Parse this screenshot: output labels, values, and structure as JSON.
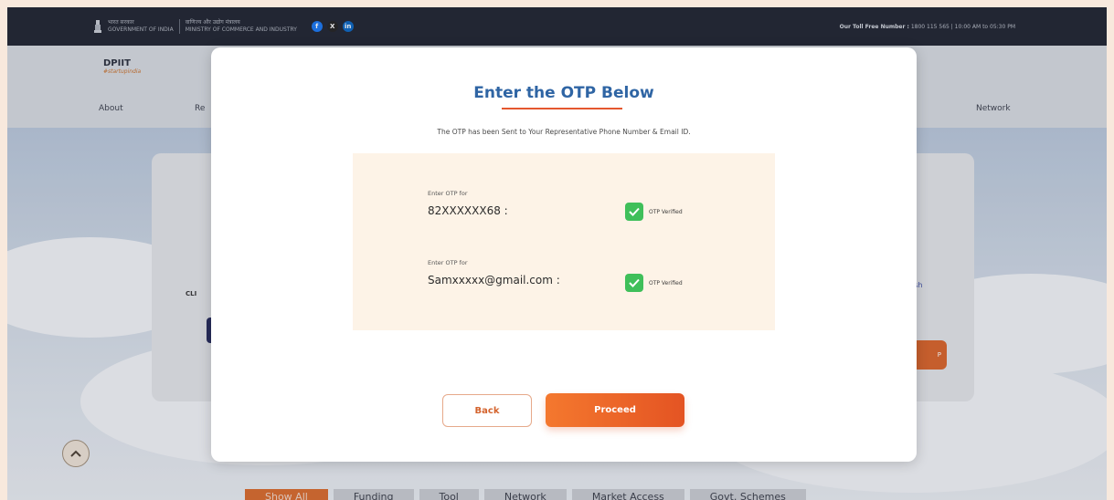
{
  "gov_bar": {
    "gov_line1": "भारत सरकार",
    "gov_line2": "GOVERNMENT OF INDIA",
    "ministry_line1": "वाणिज्य और उद्योग मंत्रालय",
    "ministry_line2": "MINISTRY OF COMMERCE AND INDUSTRY",
    "social": [
      {
        "name": "facebook",
        "glyph": "f",
        "color": "#1877f2"
      },
      {
        "name": "x",
        "glyph": "X",
        "color": "#222222"
      },
      {
        "name": "linkedin",
        "glyph": "in",
        "color": "#0a66c2"
      }
    ],
    "toll_label": "Our Toll Free Number :",
    "toll_value": "1800 115 565 | 10:00 AM to 05:30 PM"
  },
  "header": {
    "logo_text": "DPIIT",
    "logo_sub": "#startupindia",
    "nav": {
      "about": "About",
      "re": "Re",
      "network": "Network"
    }
  },
  "background": {
    "cli_text": "CLI",
    "ish_text": "ish",
    "orange_btn": "P",
    "filter_tabs": [
      "Show All",
      "Funding",
      "Tool",
      "Network",
      "Market Access",
      "Govt. Schemes"
    ]
  },
  "modal": {
    "title": "Enter the OTP Below",
    "subtitle": "The OTP has been Sent to Your Representative Phone Number & Email ID.",
    "rows": [
      {
        "label": "Enter OTP for",
        "value": "82XXXXXX68 :",
        "status": "OTP Verified"
      },
      {
        "label": "Enter OTP for",
        "value": "Samxxxxx@gmail.com :",
        "status": "OTP Verified"
      }
    ],
    "back_label": "Back",
    "proceed_label": "Proceed"
  },
  "colors": {
    "accent": "#e4572e",
    "title_blue": "#2f65a4",
    "verified_green": "#3fbf5a",
    "panel_bg": "#fdf3e7"
  }
}
